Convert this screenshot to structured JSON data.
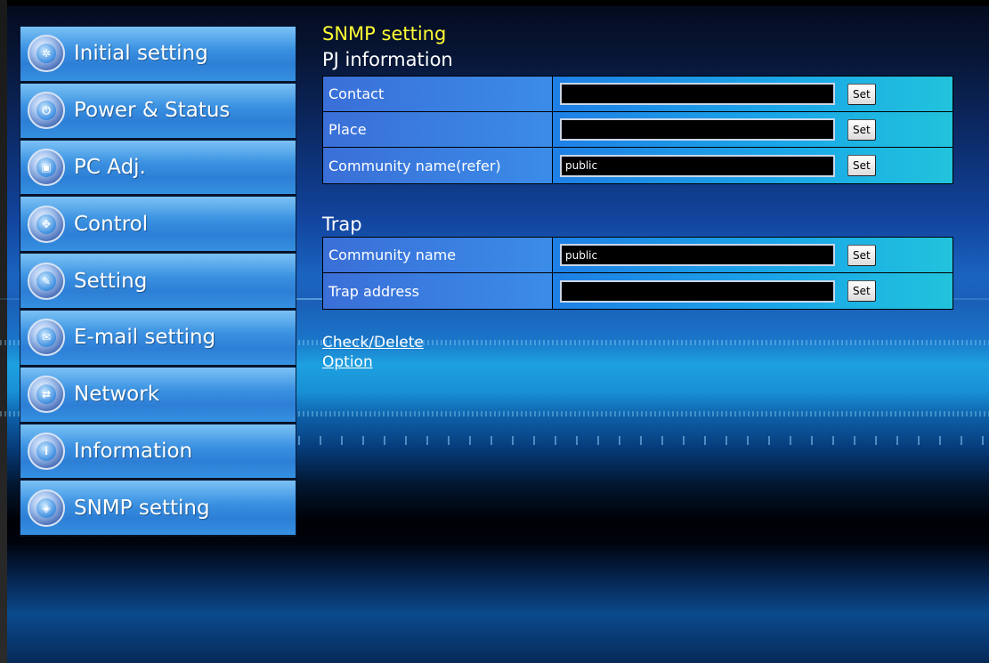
{
  "sidebar": {
    "items": [
      {
        "label": "Initial setting",
        "icon": "settings-icon",
        "glyph": "✲"
      },
      {
        "label": "Power & Status",
        "icon": "power-status-icon",
        "glyph": "⏻"
      },
      {
        "label": "PC Adj.",
        "icon": "pc-adjust-icon",
        "glyph": "▣"
      },
      {
        "label": "Control",
        "icon": "control-icon",
        "glyph": "✥"
      },
      {
        "label": "Setting",
        "icon": "wrench-icon",
        "glyph": "✎"
      },
      {
        "label": "E-mail setting",
        "icon": "envelope-icon",
        "glyph": "✉"
      },
      {
        "label": "Network",
        "icon": "network-icon",
        "glyph": "⇄"
      },
      {
        "label": "Information",
        "icon": "info-icon",
        "glyph": "i"
      },
      {
        "label": "SNMP setting",
        "icon": "snmp-icon",
        "glyph": "◈"
      }
    ]
  },
  "main": {
    "title": "SNMP setting",
    "pj_info": {
      "title": "PJ information",
      "rows": [
        {
          "label": "Contact",
          "value": "",
          "button": "Set"
        },
        {
          "label": "Place",
          "value": "",
          "button": "Set"
        },
        {
          "label": "Community name(refer)",
          "value": "public",
          "button": "Set"
        }
      ]
    },
    "trap": {
      "title": "Trap",
      "rows": [
        {
          "label": "Community name",
          "value": "public",
          "button": "Set"
        },
        {
          "label": "Trap address",
          "value": "",
          "button": "Set"
        }
      ]
    },
    "links": {
      "check_delete": "Check/Delete",
      "option": "Option"
    }
  },
  "colors": {
    "title_yellow": "#ffff33",
    "label_blue": "#3a6fd8",
    "value_cyan": "#22c3dc"
  }
}
